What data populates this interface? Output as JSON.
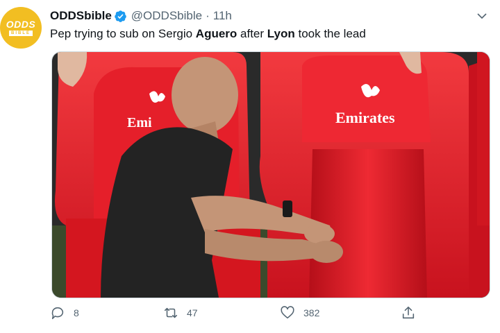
{
  "account": {
    "logo_main": "ODDS",
    "logo_sub": "BIBLE",
    "display_name": "ODDSbible",
    "handle": "@ODDSbible",
    "separator": "·",
    "time": "11h"
  },
  "tweet": {
    "parts": [
      {
        "text": "Pep trying to sub on Sergio ",
        "bold": false
      },
      {
        "text": "Aguero",
        "bold": true
      },
      {
        "text": " after ",
        "bold": false
      },
      {
        "text": "Lyon",
        "bold": true
      },
      {
        "text": " took the lead",
        "bold": false
      }
    ]
  },
  "media": {
    "seat_brand": "Emirates",
    "seat_color": "#e8202c"
  },
  "actions": {
    "reply_count": "8",
    "retweet_count": "47",
    "like_count": "382"
  },
  "colors": {
    "brand_yellow": "#f2be22",
    "verified_blue": "#1d9bf0",
    "muted": "#536471"
  }
}
